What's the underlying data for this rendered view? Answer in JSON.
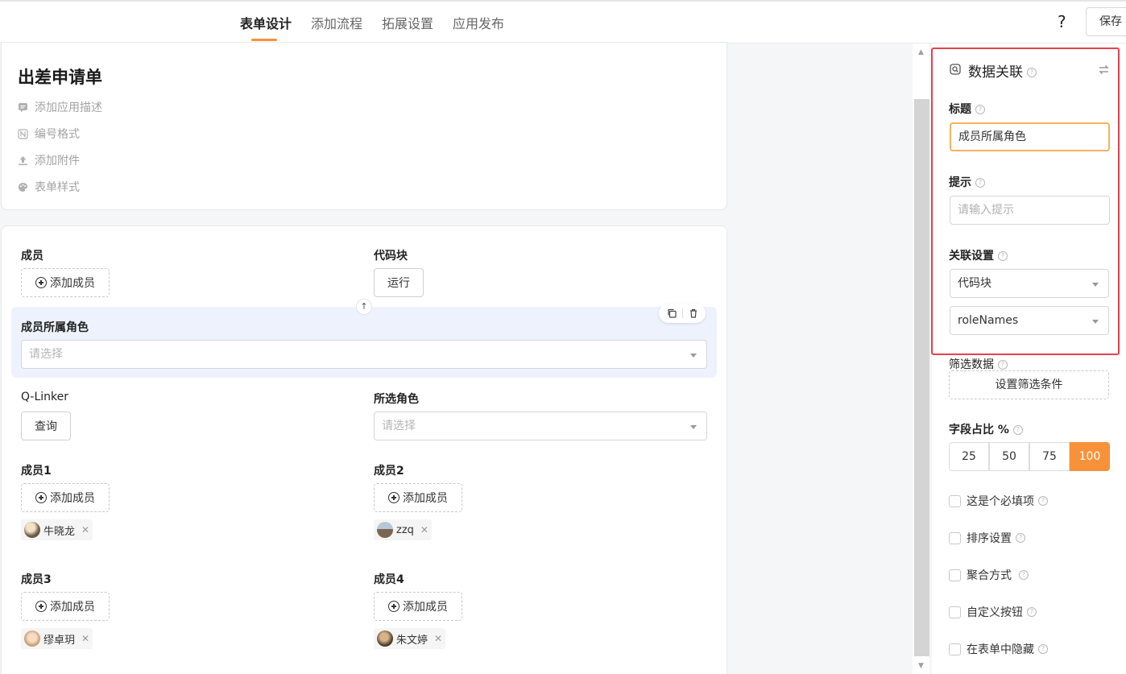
{
  "header": {
    "tabs": [
      "表单设计",
      "添加流程",
      "拓展设置",
      "应用发布"
    ],
    "active_tab": 0,
    "help_label": "?",
    "save_label": "保存"
  },
  "form": {
    "title": "出差申请单",
    "meta": [
      "添加应用描述",
      "编号格式",
      "添加附件",
      "表单样式"
    ]
  },
  "fields": {
    "member": {
      "label": "成员",
      "add_label": "添加成员"
    },
    "code_block": {
      "label": "代码块",
      "button": "运行"
    },
    "role": {
      "label": "成员所属角色",
      "placeholder": "请选择"
    },
    "qlinker": {
      "label": "Q-Linker",
      "button": "查询"
    },
    "selected_role": {
      "label": "所选角色",
      "placeholder": "请选择"
    },
    "member1": {
      "label": "成员1",
      "add_label": "添加成员",
      "tag": "牛晓龙"
    },
    "member2": {
      "label": "成员2",
      "add_label": "添加成员",
      "tag": "zzq"
    },
    "member3": {
      "label": "成员3",
      "add_label": "添加成员",
      "tag": "缪卓玥"
    },
    "member4": {
      "label": "成员4",
      "add_label": "添加成员",
      "tag": "朱文婷"
    },
    "up_arrow": "↑",
    "remove_glyph": "✕"
  },
  "panel": {
    "title": "数据关联",
    "title_label": "标题",
    "title_value": "成员所属角色",
    "hint_label": "提示",
    "hint_placeholder": "请输入提示",
    "link_label": "关联设置",
    "link_source": "代码块",
    "link_field": "roleNames",
    "filter_label": "筛选数据",
    "filter_button": "设置筛选条件",
    "width_label": "字段占比 %",
    "width_options": [
      "25",
      "50",
      "75",
      "100"
    ],
    "width_selected": "100",
    "checks": [
      "这是个必填项",
      "排序设置",
      "聚合方式",
      "自定义按钮",
      "在表单中隐藏"
    ]
  },
  "colors": {
    "accent": "#f7923a",
    "highlight_border": "#e8404e",
    "selected_field_bg": "#eef2fd"
  }
}
